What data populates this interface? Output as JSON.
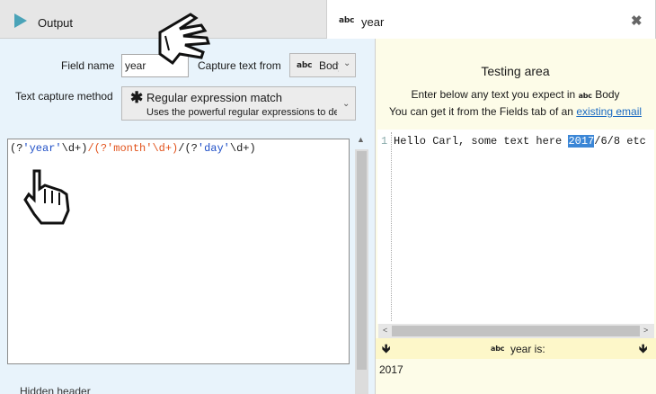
{
  "tabs": {
    "output_label": "Output",
    "year_icon": "abc",
    "year_label": "year",
    "close_symbol": "✖"
  },
  "form": {
    "field_name_label": "Field name",
    "field_name_value": "year",
    "capture_from_label": "Capture text from",
    "capture_icon": "abc",
    "capture_value": "Body",
    "method_label": "Text capture method",
    "method_icon": "✱",
    "method_title": "Regular expression match",
    "method_desc": "Uses the powerful regular expressions to detect"
  },
  "regex": {
    "p1_open": "(?",
    "p1_name": "'year'",
    "p1_rest": "\\d+)",
    "sep1": "/",
    "p2": "(?'month'\\d+)",
    "sep2": "/",
    "p3_open": "(?",
    "p3_name": "'day'",
    "p3_rest": "\\d+)"
  },
  "left_bottom_text": "Hidden header",
  "testing": {
    "title": "Testing area",
    "hint_prefix": "Enter below any text you expect in",
    "hint_icon": "abc",
    "hint_field": "Body",
    "hint2_prefix": "You can get it from the Fields tab of an",
    "hint2_link": "existing email",
    "line_number": "1",
    "text_before": "Hello Carl, some text here ",
    "text_match": "2017",
    "text_after": "/6/8 etc",
    "result_icon": "abc",
    "result_label": "year is:",
    "result_value": "2017"
  },
  "colors": {
    "group_blue": "#1f4fc7",
    "group_orange": "#e2531c",
    "left_bg": "#e8f3fb",
    "right_bg": "#fdfce8",
    "highlight": "#3b86d6",
    "link": "#1a6ac2"
  }
}
